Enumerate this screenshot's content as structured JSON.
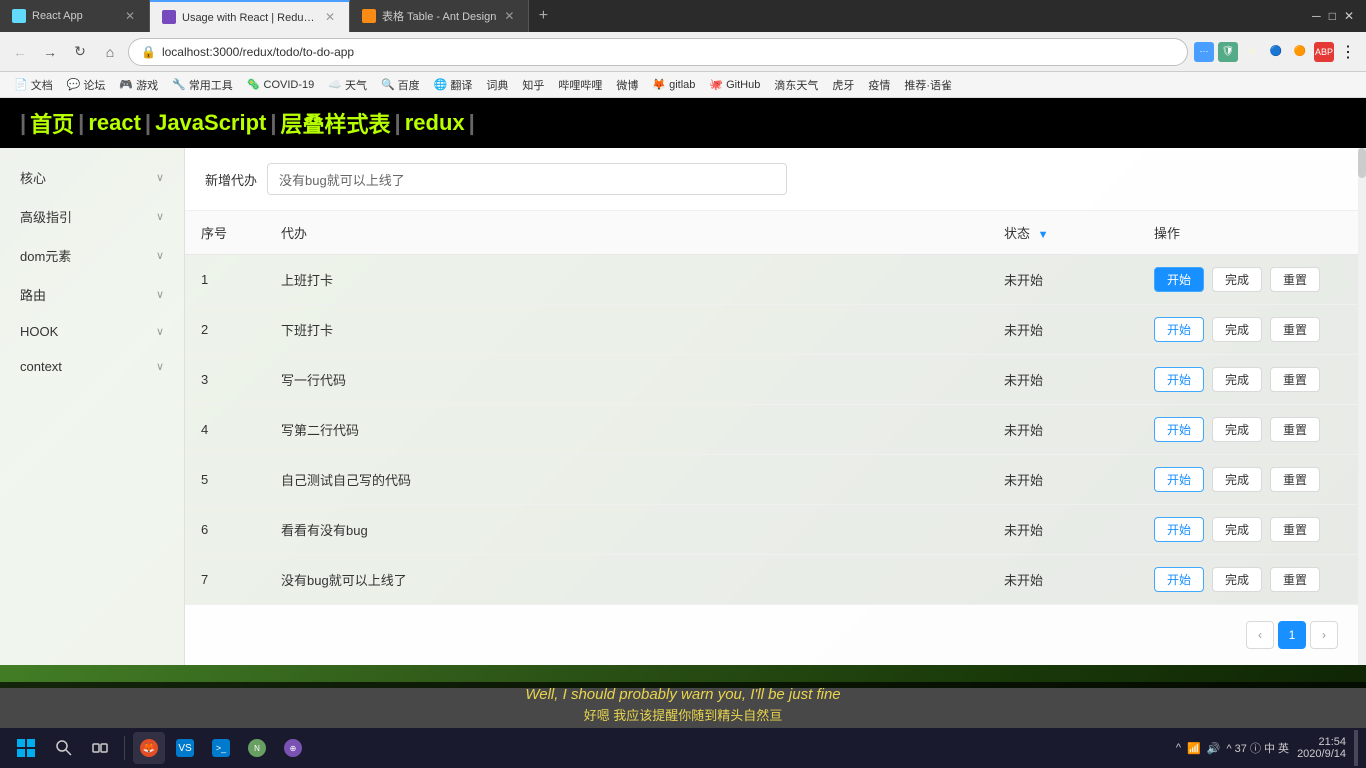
{
  "browser": {
    "tabs": [
      {
        "id": "tab1",
        "title": "React App",
        "favicon": "react",
        "active": false,
        "url": ""
      },
      {
        "id": "tab2",
        "title": "Usage with React | Redux中",
        "favicon": "react",
        "active": true,
        "url": ""
      },
      {
        "id": "tab3",
        "title": "表格 Table - Ant Design",
        "favicon": "ant",
        "active": false,
        "url": ""
      }
    ],
    "address": "localhost:3000/redux/todo/to-do-app",
    "address_prefix": "① ⓘ"
  },
  "bookmarks": [
    {
      "label": "文档",
      "icon": "📄"
    },
    {
      "label": "论坛",
      "icon": "💬"
    },
    {
      "label": "游戏",
      "icon": "🎮"
    },
    {
      "label": "常用工具",
      "icon": "🔧"
    },
    {
      "label": "COVID-19",
      "icon": "🦠"
    },
    {
      "label": "天气",
      "icon": "☁️"
    },
    {
      "label": "百度",
      "icon": "🔍"
    },
    {
      "label": "翻译",
      "icon": "🌐"
    },
    {
      "label": "词典",
      "icon": "📖"
    },
    {
      "label": "知乎",
      "icon": "Z"
    },
    {
      "label": "哔哩哔哩",
      "icon": "▶"
    },
    {
      "label": "微博",
      "icon": "微"
    },
    {
      "label": "gitlab",
      "icon": "🦊"
    },
    {
      "label": "GitHub",
      "icon": "🐙"
    },
    {
      "label": "滴东天气",
      "icon": "🌤"
    },
    {
      "label": "虎牙",
      "icon": "🐯"
    },
    {
      "label": "疫情",
      "icon": "💊"
    },
    {
      "label": "推荐·语雀",
      "icon": "📝"
    }
  ],
  "nav": {
    "links": [
      {
        "label": "首页"
      },
      {
        "label": "react"
      },
      {
        "label": "JavaScript"
      },
      {
        "label": "层叠样式表"
      },
      {
        "label": "redux"
      }
    ]
  },
  "sidebar": {
    "items": [
      {
        "label": "核心",
        "has_arrow": true
      },
      {
        "label": "高级指引",
        "has_arrow": true
      },
      {
        "label": "dom元素",
        "has_arrow": true
      },
      {
        "label": "路由",
        "has_arrow": true
      },
      {
        "label": "HOOK",
        "has_arrow": true
      },
      {
        "label": "context",
        "has_arrow": true
      }
    ]
  },
  "todo": {
    "input_label": "新增代办",
    "input_placeholder": "没有bug就可以上线了",
    "table": {
      "columns": [
        {
          "key": "seq",
          "label": "序号"
        },
        {
          "key": "task",
          "label": "代办"
        },
        {
          "key": "status",
          "label": "状态",
          "has_filter": true
        },
        {
          "key": "actions",
          "label": "操作"
        }
      ],
      "rows": [
        {
          "seq": "1",
          "task": "上班打卡",
          "status": "未开始",
          "start_active": true
        },
        {
          "seq": "2",
          "task": "下班打卡",
          "status": "未开始",
          "start_active": false
        },
        {
          "seq": "3",
          "task": "写一行代码",
          "status": "未开始",
          "start_active": false
        },
        {
          "seq": "4",
          "task": "写第二行代码",
          "status": "未开始",
          "start_active": false
        },
        {
          "seq": "5",
          "task": "自己测试自己写的代码",
          "status": "未开始",
          "start_active": false
        },
        {
          "seq": "6",
          "task": "看看有没有bug",
          "status": "未开始",
          "start_active": false
        },
        {
          "seq": "7",
          "task": "没有bug就可以上线了",
          "status": "未开始",
          "start_active": false
        }
      ],
      "action_labels": {
        "start": "开始",
        "complete": "完成",
        "reset": "重置"
      }
    },
    "pagination": {
      "prev": "‹",
      "current": "1",
      "next": "›"
    }
  },
  "subtitle": {
    "en": "Well, I should probably warn you, I'll be just fine",
    "cn": "好嗯 我应该提醒你随到精头自然亘"
  },
  "taskbar": {
    "time": "21:54",
    "date": "2020/9/14",
    "sys_area": "^ 37 ⓘ 中 英"
  }
}
